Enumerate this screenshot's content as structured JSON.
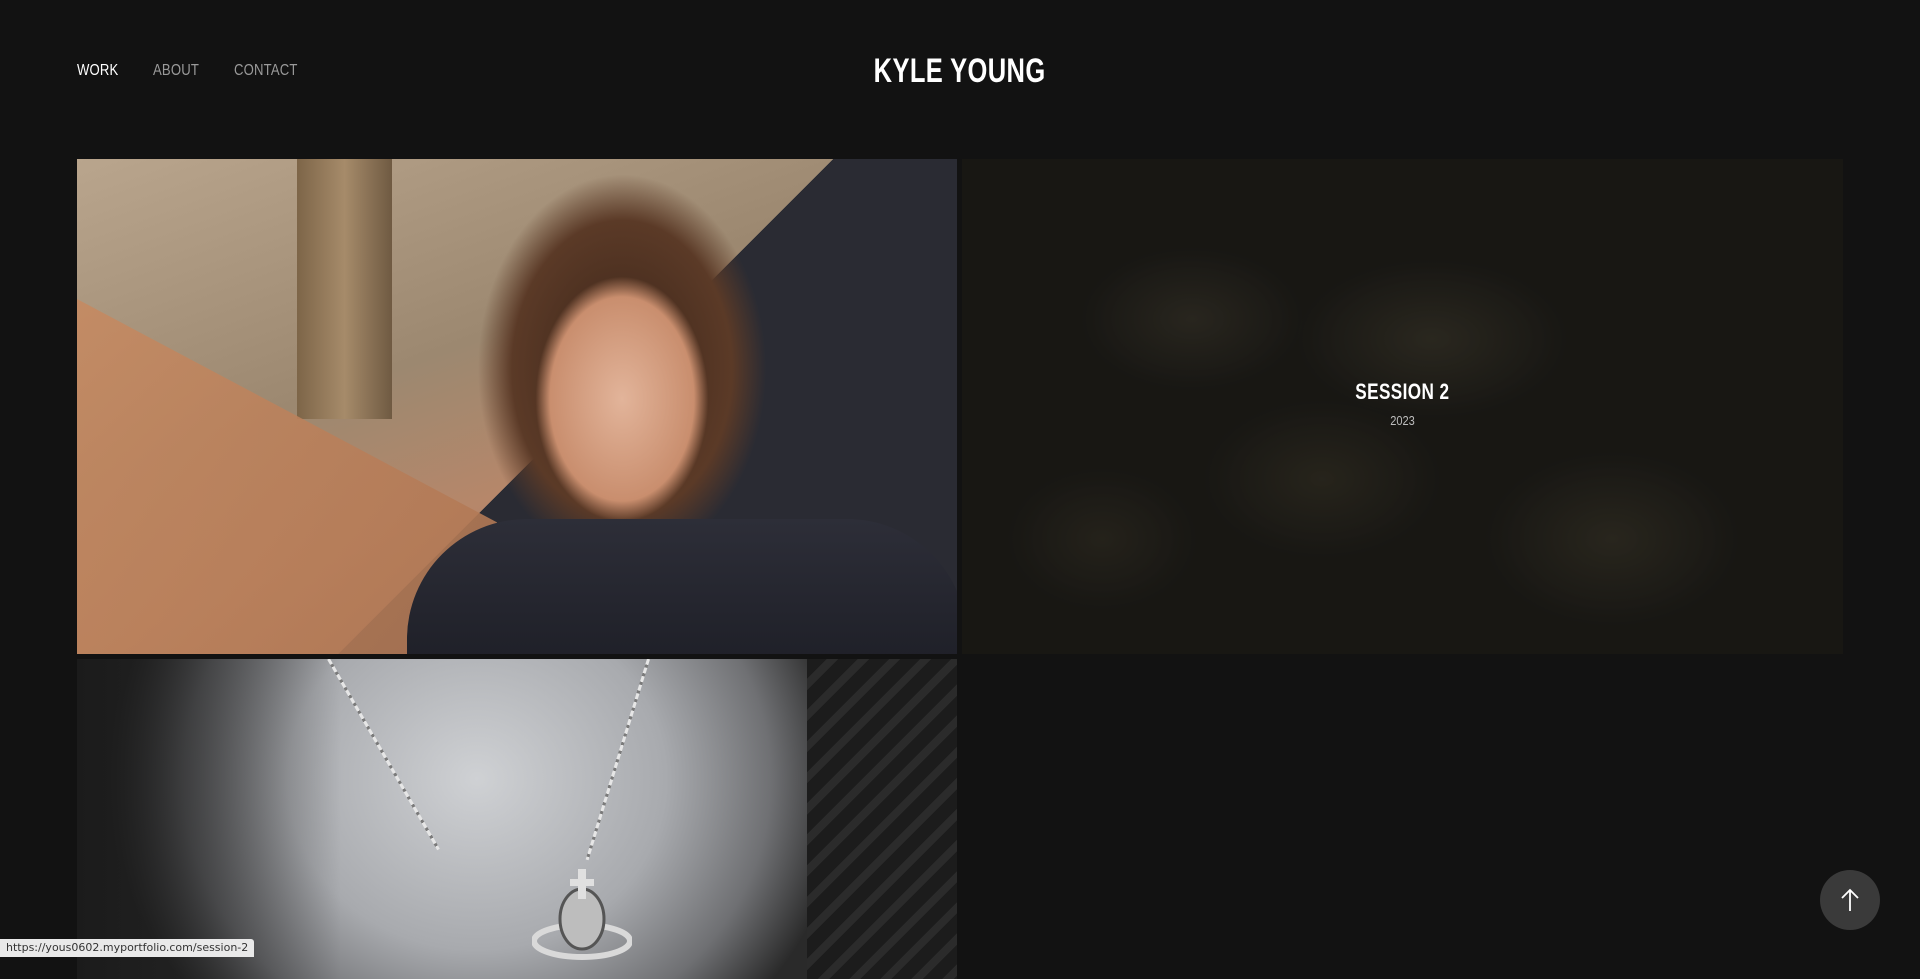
{
  "site": {
    "title": "KYLE YOUNG"
  },
  "nav": {
    "items": [
      {
        "label": "WORK"
      },
      {
        "label": "ABOUT"
      },
      {
        "label": "CONTACT"
      }
    ]
  },
  "gallery": {
    "tiles": [
      {
        "title": "",
        "year": ""
      },
      {
        "title": "SESSION 2",
        "year": "2023"
      },
      {
        "title": "",
        "year": ""
      }
    ]
  },
  "status_bar": {
    "url": "https://yous0602.myportfolio.com/session-2"
  },
  "icons": {
    "back_to_top": "arrow-up-icon"
  }
}
